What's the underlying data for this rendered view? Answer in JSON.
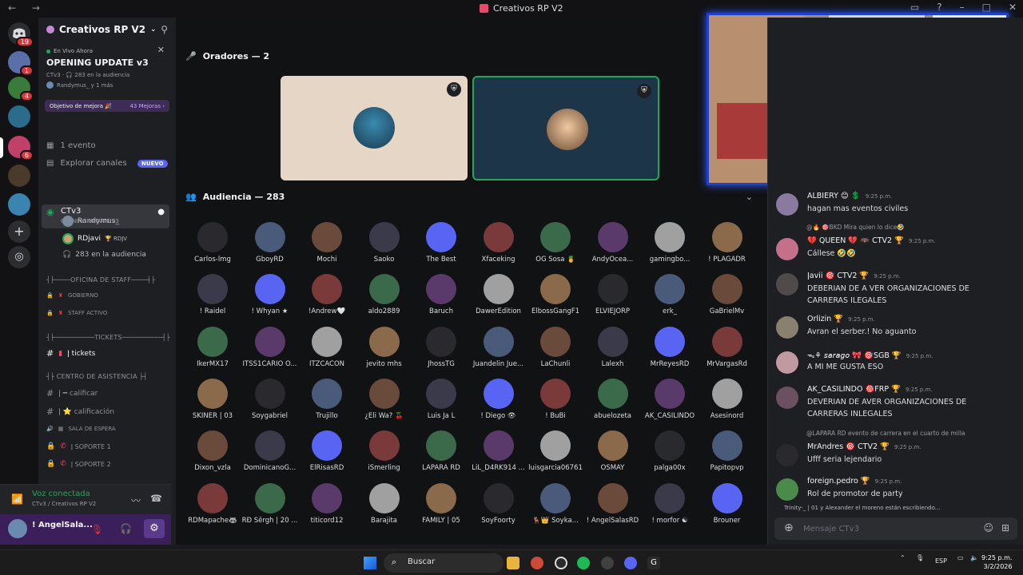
{
  "window": {
    "title": "Creativos RP V2",
    "nav": "← →"
  },
  "rail": {
    "badges": [
      "19",
      "1",
      "4",
      "6"
    ]
  },
  "sidebar": {
    "server_name": "Creativos RP V2",
    "live": {
      "tag": "En Vivo Ahora",
      "title": "OPENING UPDATE v3",
      "sub": "CTv3 · 🎧 283 en la audiencia",
      "attendees": "Randymus_ y 1 más"
    },
    "boost": {
      "label": "Objetivo de mejora 🎉",
      "count": "43 Mejoras ›"
    },
    "events": "1 evento",
    "explore": "Explorar canales",
    "explore_badge": "NUEVO",
    "active_channel": {
      "name": "CTv3",
      "topic": "OPENING UPDATE v3"
    },
    "stage_members": [
      {
        "name": "Randymus_"
      },
      {
        "name": "RDjavi",
        "tag": "🏆 RDJV"
      }
    ],
    "audience_count": "283 en la audiencia",
    "categories": {
      "staff": "┤├────OFICINA DE STAFF────┤├",
      "tickets": "┤├──────────TICKETS──────────┤├",
      "asistencia": "┤├ CENTRO DE ASISTENCIA ├┤"
    },
    "channels": {
      "gobierno": "GOBIERNO",
      "staff_activo": "STAFF ACTIVO",
      "tickets": "ǀ tickets",
      "calificar": "ǀ ━ calificar",
      "calificacion": "ǀ ⭐ calificación",
      "sala_espera": "SALA DE ESPERA",
      "soporte1": "ǀ SOPORTE 1",
      "soporte2": "ǀ SOPORTE 2"
    },
    "voice": {
      "title": "Voz conectada",
      "sub": "CTv3 / Creativos RP V2"
    },
    "user": {
      "name": "! AngelSala..."
    }
  },
  "stage": {
    "speakers_header": "Oradores — 2",
    "audience_header": "Audiencia — 283",
    "audience": [
      [
        "Carlos-lmg",
        "GboyRD",
        "Mochi",
        "Saoko",
        "The Best",
        "Xfaceking",
        "OG Sosa 🍍",
        "AndyOcea...",
        "gamingbo...",
        "! PLAGADR"
      ],
      [
        "! Raidel",
        "! Whyan ★",
        "!Andrew🤍",
        "aldo2889",
        "Baruch",
        "DawerEdition",
        "ElbossGangF1",
        "ELVIEJORP",
        "erk_",
        "GaBrielMv"
      ],
      [
        "IkerMX17",
        "ITSS1CARIO O...",
        "ITZCACON",
        "jevito mhs",
        "JhossTG",
        "Juandelin Jue...",
        "LaChunli",
        "Lalexh",
        "MrReyesRD",
        "MrVargasRd"
      ],
      [
        "SKINER | 03",
        "Soygabriel",
        "Trujillo",
        "¿Eli Wa? 🍒",
        "Luis Ja L",
        "! Diego 👁",
        "! BuBi",
        "abuelozeta",
        "AK_CASILINDO",
        "Asesinord"
      ],
      [
        "Dixon_vzla",
        "DominicanoG...",
        "ElRisasRD",
        "iSmerling",
        "LAPARA RD",
        "LiL_D4RK914 ...",
        "luisgarcia06761",
        "OSMAY",
        "palga00x",
        "Papitopvp"
      ],
      [
        "RDMapache🦝",
        "RÐ Šêrgh | 20 ...",
        "titicord12",
        "Barajita",
        "FAMILY | 05",
        "SoyFoorty",
        "🦌👑 Soyka...",
        "! AngelSalasRD",
        "! morfor ☯",
        "Brouner"
      ]
    ]
  },
  "chat": {
    "messages": [
      {
        "author": "ALBIERY 😊 💲",
        "time": "9:25 p.m.",
        "text": "hagan mas eventos civiles"
      },
      {
        "reply": "@🔥 🎯BKD Mira quien lo dice🤣",
        "author": "💔 QUEEN 💔 🦇 CTV2 🏆",
        "time": "9:25 p.m.",
        "text": "Cállese 🤣🤣"
      },
      {
        "author": "ǀavii 🎯 CTV2 🏆",
        "time": "9:25 p.m.",
        "text": "DEBERIAN DE A VER ORGANIZACIONES DE CARRERAS ILEGALES"
      },
      {
        "author": "Orlizin 🏆",
        "time": "9:25 p.m.",
        "text": "Avran el serber.! No aguanto"
      },
      {
        "author": "ᯓ⚘ 𝘴𝘢𝘳𝘢𝘨𝘰 🎀 🎯SGB 🏆",
        "time": "9:25 p.m.",
        "text": "A MI ME GUSTA ESO"
      },
      {
        "author": "AK_CASILINDO 🎯FRP 🏆",
        "time": "9:25 p.m.",
        "text": "DEVERIAN DE AVER ORGANIZACIONES DE CARRERAS INLEGALES"
      },
      {
        "reply": "@LAPARA RD evento de carrera en el cuarto de milla",
        "author": "MrAndres 🎯 CTV2 🏆",
        "time": "9:25 p.m.",
        "text": "Ufff seria lejendario"
      },
      {
        "author": "foreign.pedro 🏆",
        "time": "9:25 p.m.",
        "text": "Rol de promotor de party"
      }
    ],
    "typing": "Trinity-_ | 01 y Alexander el moreno están escribiendo...",
    "input_placeholder": "Mensaje CTv3"
  },
  "taskbar": {
    "search_placeholder": "Buscar",
    "lang": "ESP",
    "time": "9:25 p.m.",
    "date": "3/2/2026"
  }
}
